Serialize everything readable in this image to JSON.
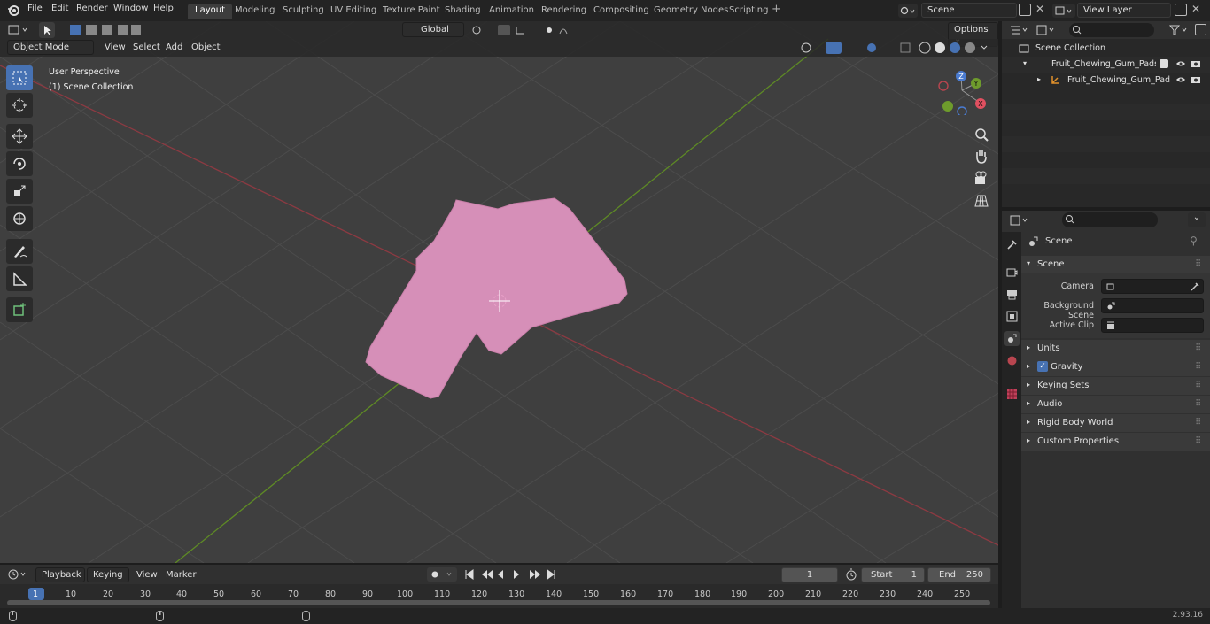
{
  "menus": [
    "File",
    "Edit",
    "Render",
    "Window",
    "Help"
  ],
  "workspace_tabs": [
    "Layout",
    "Modeling",
    "Sculpting",
    "UV Editing",
    "Texture Paint",
    "Shading",
    "Animation",
    "Rendering",
    "Compositing",
    "Geometry Nodes",
    "Scripting"
  ],
  "active_tab": "Layout",
  "scene_field": "Scene",
  "view_layer_field": "View Layer",
  "viewport": {
    "mode": "Object Mode",
    "menus": [
      "View",
      "Select",
      "Add",
      "Object"
    ],
    "orientation": "Global",
    "options_label": "Options",
    "overlay_title": "User Perspective",
    "overlay_subtitle": "(1) Scene Collection",
    "gizmo_labels": {
      "x": "X",
      "y": "Y",
      "z": "Z"
    }
  },
  "outliner": {
    "root": "Scene Collection",
    "collection": "Fruit_Chewing_Gum_Pads_Pu",
    "object": "Fruit_Chewing_Gum_Pad"
  },
  "properties": {
    "header_title": "Scene",
    "panel": "Scene",
    "camera_label": "Camera",
    "background_scene_label": "Background Scene",
    "active_clip_label": "Active Clip",
    "subpanels": [
      "Units",
      "Gravity",
      "Keying Sets",
      "Audio",
      "Rigid Body World",
      "Custom Properties"
    ],
    "gravity_checked": true
  },
  "timeline": {
    "menus": [
      "Playback",
      "Keying",
      "View",
      "Marker"
    ],
    "current_frame": "1",
    "start_label": "Start",
    "start": "1",
    "end_label": "End",
    "end": "250",
    "ticks": [
      "1",
      "10",
      "20",
      "30",
      "40",
      "50",
      "60",
      "70",
      "80",
      "90",
      "100",
      "110",
      "120",
      "130",
      "140",
      "150",
      "160",
      "170",
      "180",
      "190",
      "200",
      "210",
      "220",
      "230",
      "240",
      "250"
    ]
  },
  "status": {
    "version": "2.93.16"
  },
  "colors": {
    "accent": "#4772b3",
    "object": "#d68fb8",
    "x_axis": "#b8454f",
    "y_axis": "#6e9b2c"
  }
}
